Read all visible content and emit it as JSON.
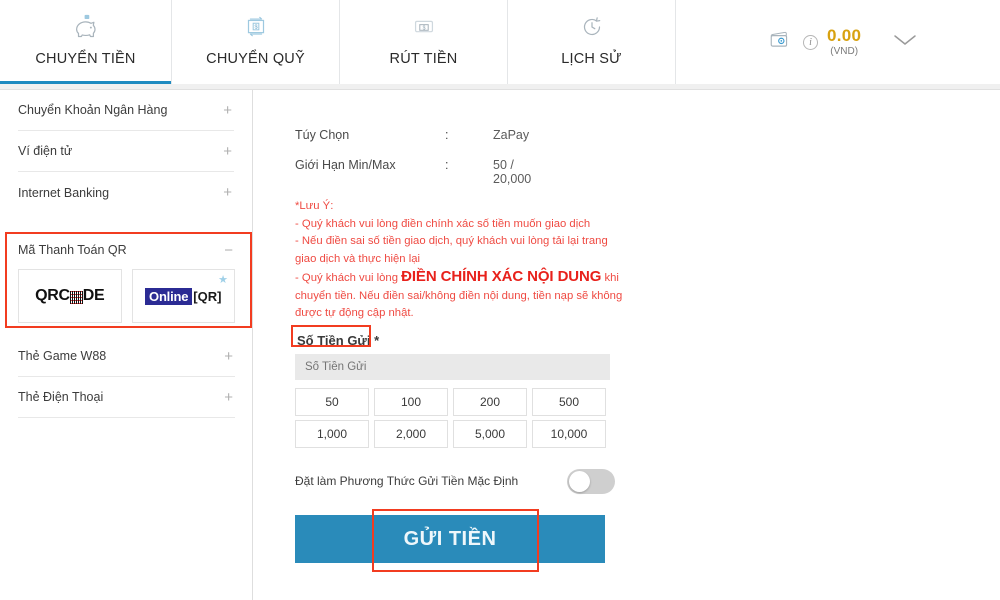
{
  "nav": {
    "tabs": [
      {
        "label": "CHUYỂN TIỀN",
        "icon": "piggy-bank-icon",
        "active": true
      },
      {
        "label": "CHUYỂN QUỸ",
        "icon": "fund-transfer-icon",
        "active": false
      },
      {
        "label": "RÚT TIỀN",
        "icon": "atm-withdraw-icon",
        "active": false
      },
      {
        "label": "LỊCH SỬ",
        "icon": "clock-history-icon",
        "active": false
      }
    ],
    "wallet": {
      "icon": "wallet-icon",
      "info_icon": "info-icon",
      "amount": "0.00",
      "currency": "(VND)",
      "chevron": "chevron-down-icon"
    }
  },
  "sidebar": {
    "items": [
      {
        "label": "Chuyển Khoản Ngân Hàng",
        "toggle": "+"
      },
      {
        "label": "Ví điện tử",
        "toggle": "+"
      },
      {
        "label": "Internet Banking",
        "toggle": "+"
      }
    ],
    "qr_group": {
      "label": "Mã Thanh Toán QR",
      "toggle": "−",
      "tiles": [
        {
          "name": "qrcode-logo",
          "text_left": "QRC",
          "text_right": "DE"
        },
        {
          "name": "online-qr-logo",
          "text_left": "Online",
          "text_right": "[QR]",
          "badge": "★"
        }
      ]
    },
    "items_after": [
      {
        "label": "Thẻ Game W88",
        "toggle": "+"
      },
      {
        "label": "Thẻ Điện Thoại",
        "toggle": "+"
      }
    ]
  },
  "main": {
    "rows": [
      {
        "key": "Túy Chọn",
        "colon": ":",
        "value": "ZaPay"
      },
      {
        "key": "Giới Hạn Min/Max",
        "colon": ":",
        "value": "50 / 20,000"
      }
    ],
    "notice": {
      "title": "*Lưu Ý:",
      "line1": "- Quý khách vui lòng điền chính xác số tiền muốn giao dịch",
      "line2": "- Nếu điền sai số tiền giao dịch, quý khách vui lòng tải lại trang giao dịch và thực hiện lại",
      "line3_pre": "- Quý khách vui lòng ",
      "line3_big": "ĐIỀN CHÍNH XÁC NỘI DUNG",
      "line3_post": " khi chuyển tiền. Nếu điền sai/không điền nội dung, tiền nạp sẽ không được tự động cập nhật."
    },
    "amount_field": {
      "label": "Số Tiền Gửi *",
      "placeholder": "Số Tiền Gửi",
      "value": ""
    },
    "presets": [
      "50",
      "100",
      "200",
      "500",
      "1,000",
      "2,000",
      "5,000",
      "10,000"
    ],
    "default_method": {
      "label": "Đặt làm Phương Thức Gửi Tiền Mặc Định",
      "enabled": false
    },
    "submit_label": "GỬI TIỀN"
  },
  "colors": {
    "accent_blue": "#2a8bba",
    "highlight_red": "#f23c20",
    "amount_gold": "#d8a211",
    "notice_red": "#ef4a42"
  }
}
